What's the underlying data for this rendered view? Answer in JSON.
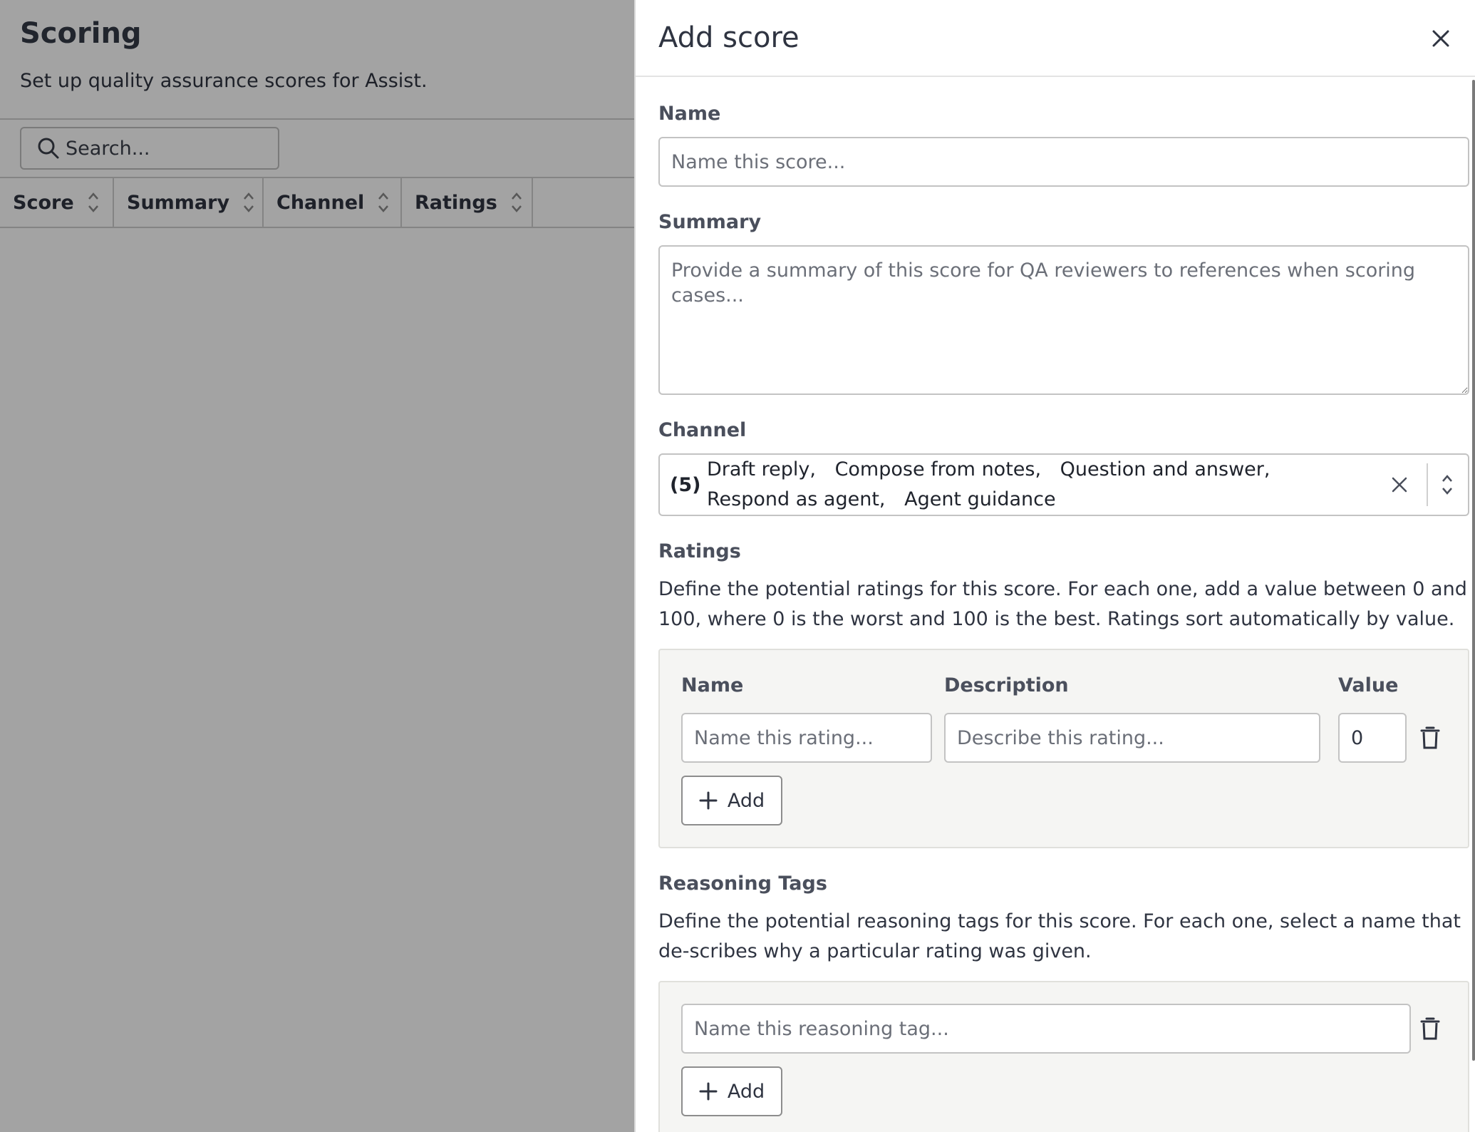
{
  "background": {
    "title": "Scoring",
    "subtitle": "Set up quality assurance scores for Assist.",
    "search_placeholder": "Search...",
    "columns": [
      {
        "label": "Score"
      },
      {
        "label": "Summary"
      },
      {
        "label": "Channel"
      },
      {
        "label": "Ratings"
      }
    ]
  },
  "drawer": {
    "title": "Add score",
    "close_icon": "close-icon",
    "name": {
      "label": "Name",
      "placeholder": "Name this score...",
      "value": ""
    },
    "summary": {
      "label": "Summary",
      "placeholder": "Provide a summary of this score for QA reviewers to references when scoring cases...",
      "value": ""
    },
    "channel": {
      "label": "Channel",
      "count": "(5)",
      "selected": [
        "Draft reply,",
        "Compose from notes,",
        "Question and answer,",
        "Respond as agent,",
        "Agent guidance"
      ]
    },
    "ratings": {
      "label": "Ratings",
      "help": "Define the potential ratings for this score. For each one, add a value between 0 and 100, where 0 is the worst and 100 is the best. Ratings sort automatically by value.",
      "col_name": "Name",
      "col_description": "Description",
      "col_value": "Value",
      "row": {
        "name_placeholder": "Name this rating...",
        "description_placeholder": "Describe this rating...",
        "value": "0"
      },
      "add_label": "Add"
    },
    "reasoning_tags": {
      "label": "Reasoning Tags",
      "help": "Define the potential reasoning tags for this score. For each one, select a name that de-scribes why a particular rating was given.",
      "row": {
        "name_placeholder": "Name this reasoning tag..."
      },
      "add_label": "Add"
    }
  },
  "colors": {
    "overlay": "#000000",
    "text": "#2f3441",
    "label": "#4a4f5c",
    "border": "#c3c3c3",
    "panel_bg": "#f5f5f3"
  }
}
